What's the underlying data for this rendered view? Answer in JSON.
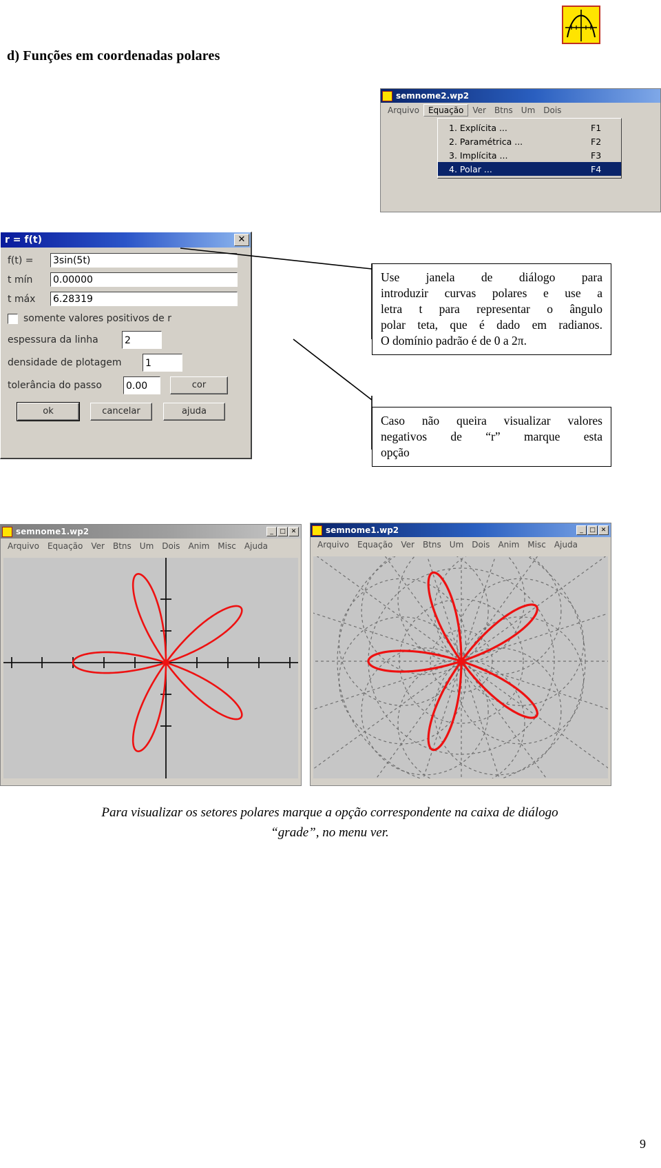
{
  "document": {
    "heading": "d) Funções em coordenadas polares",
    "page_number": "9",
    "bottom_caption_line1": "Para visualizar os setores polares marque a opção correspondente na caixa de diálogo",
    "bottom_caption_line2": "“grade”, no menu ver."
  },
  "logo": {
    "name": "winplot-logo-icon",
    "background": "#ffe400",
    "border": "#c03020"
  },
  "menu_window": {
    "title": "semnome2.wp2",
    "menu_items": [
      "Arquivo",
      "Equação",
      "Ver",
      "Btns",
      "Um",
      "Dois"
    ],
    "open_menu": "Equação",
    "dropdown": [
      {
        "label": "1. Explícita ...",
        "shortcut": "F1",
        "selected": false
      },
      {
        "label": "2. Paramétrica ...",
        "shortcut": "F2",
        "selected": false
      },
      {
        "label": "3. Implícita ...",
        "shortcut": "F3",
        "selected": false
      },
      {
        "label": "4. Polar ...",
        "shortcut": "F4",
        "selected": true
      }
    ]
  },
  "polar_dialog": {
    "title": "r = f(t)",
    "close_label": "✕",
    "fields": [
      {
        "label": "f(t) =",
        "value": "3sin(5t)"
      },
      {
        "label": "t mín",
        "value": "0.00000"
      },
      {
        "label": "t máx",
        "value": "6.28319"
      }
    ],
    "checkbox_label": "somente valores positivos de r",
    "checkbox_checked": false,
    "line_thickness_label": "espessura da linha",
    "line_thickness_value": "2",
    "plot_density_label": "densidade de plotagem",
    "plot_density_value": "1",
    "step_tolerance_label": "tolerância do passo",
    "step_tolerance_value": "0.00",
    "color_button": "cor",
    "ok_button": "ok",
    "cancel_button": "cancelar",
    "help_button": "ajuda"
  },
  "callouts": {
    "first": {
      "lines": [
        "Use janela de diálogo para",
        "introduzir curvas polares e use a",
        "letra t para representar o ângulo",
        "polar teta, que é dado em radianos.",
        "O domínio padrão é de 0 a 2π."
      ]
    },
    "second": {
      "lines": [
        "Caso não queira visualizar valores",
        "negativos de “r” marque esta",
        "opção"
      ]
    }
  },
  "plot_window_left": {
    "title": "semnome1.wp2",
    "active": false,
    "menu_items": [
      "Arquivo",
      "Equação",
      "Ver",
      "Btns",
      "Um",
      "Dois",
      "Anim",
      "Misc",
      "Ajuda"
    ],
    "window_buttons": [
      "_",
      "□",
      "✕"
    ],
    "grid_mode": "cartesian-axes"
  },
  "plot_window_right": {
    "title": "semnome1.wp2",
    "active": true,
    "menu_items": [
      "Arquivo",
      "Equação",
      "Ver",
      "Btns",
      "Um",
      "Dois",
      "Anim",
      "Misc",
      "Ajuda"
    ],
    "window_buttons": [
      "_",
      "□",
      "✕"
    ],
    "grid_mode": "polar-sectors"
  },
  "chart_data": {
    "type": "line",
    "title": "r = 3sin(5t)",
    "equation": "3sin(5t)",
    "coordinate_system": "polar",
    "petals": 5,
    "amplitude": 3,
    "t_min": 0.0,
    "t_max": 6.28319,
    "curve_color": "#ee1111",
    "line_width": 2,
    "axis_color": "#000000",
    "plot_background": "#c6c6c6",
    "left_plot": {
      "grid": "cartesian axes with tick marks",
      "x_ticks": [
        -4,
        -3,
        -2,
        -1,
        0,
        1,
        2,
        3,
        4
      ],
      "y_ticks": [
        -2,
        -1,
        0,
        1,
        2
      ]
    },
    "right_plot": {
      "grid": "polar sector grid, dashed gray",
      "radial_rings": 4,
      "sector_lines": 10
    }
  }
}
